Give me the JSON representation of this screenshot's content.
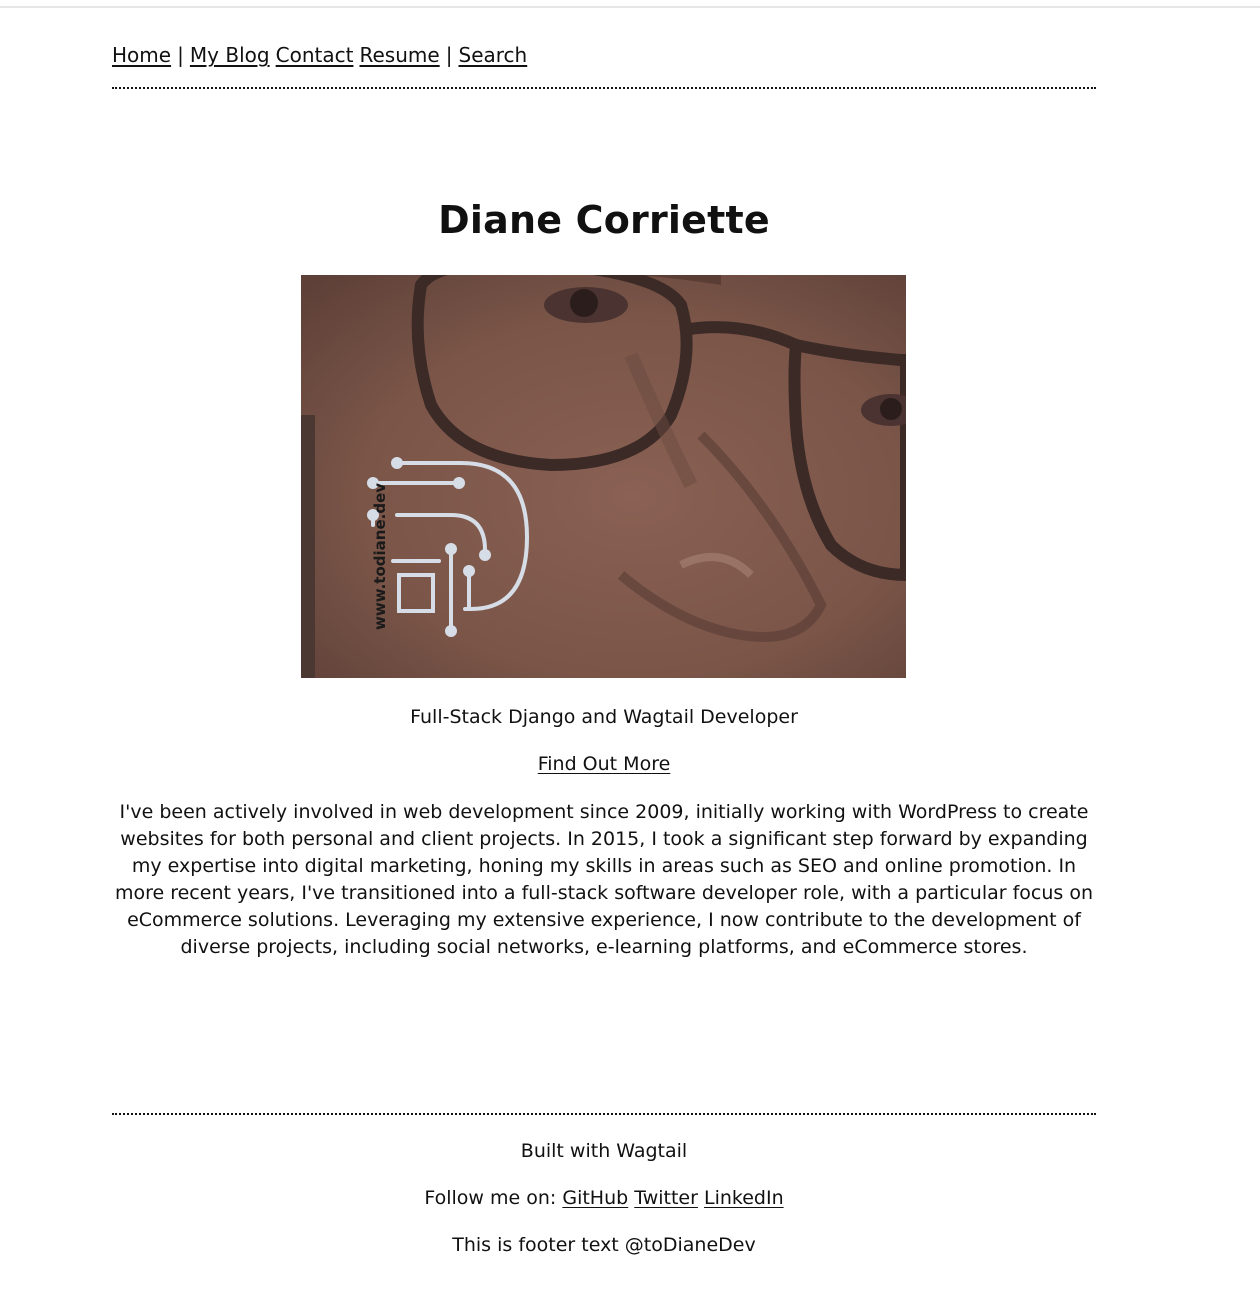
{
  "nav": {
    "home": "Home",
    "sep1": "|",
    "blog": "My Blog",
    "contact": "Contact",
    "resume": "Resume",
    "sep2": "|",
    "search": "Search"
  },
  "hero": {
    "name": "Diane Corriette",
    "image_watermark": "www.todiane.dev",
    "tagline": "Full-Stack Django and Wagtail Developer",
    "cta": "Find Out More",
    "bio": "I've been actively involved in web development since 2009, initially working with WordPress to create websites for both personal and client projects. In 2015, I took a significant step forward by expanding my expertise into digital marketing, honing my skills in areas such as SEO and online promotion. In more recent years, I've transitioned into a full-stack software developer role, with a particular focus on eCommerce solutions. Leveraging my extensive experience, I now contribute to the development of diverse projects, including social networks, e-learning platforms, and eCommerce stores."
  },
  "footer": {
    "built_with": "Built with Wagtail",
    "follow_label": "Follow me on:",
    "github": "GitHub",
    "twitter": "Twitter",
    "linkedin": "LinkedIn",
    "footer_text": "This is footer text @toDianeDev"
  },
  "colors": {
    "text": "#111111",
    "hero_bg": "#7a5548",
    "logo_stroke": "#d6dde6"
  }
}
